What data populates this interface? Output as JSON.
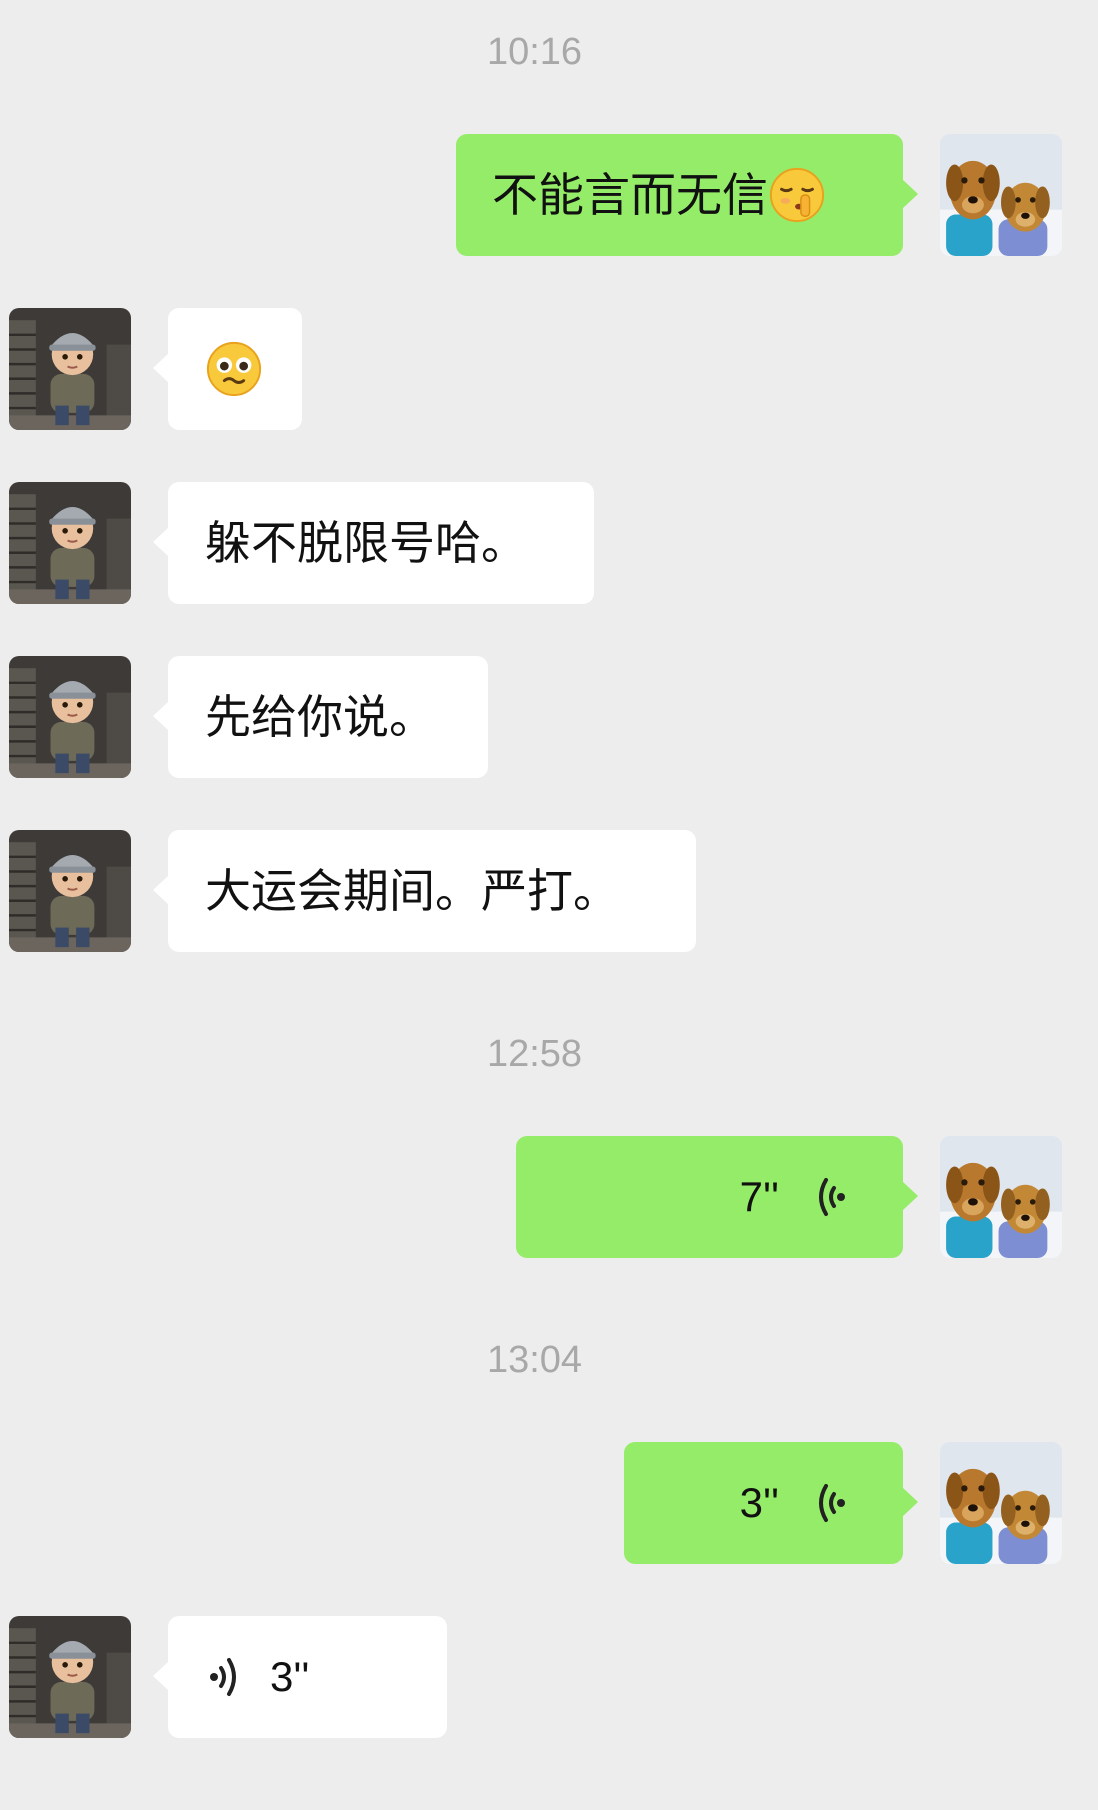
{
  "timestamps": [
    "10:16",
    "12:58",
    "13:04"
  ],
  "messages": [
    {
      "side": "out",
      "type": "text",
      "text": "不能言而无信",
      "emoji": "shushing-face-emoji"
    },
    {
      "side": "in",
      "type": "emoji",
      "emoji": "pleading-face-emoji"
    },
    {
      "side": "in",
      "type": "text",
      "text": "躲不脱限号哈。"
    },
    {
      "side": "in",
      "type": "text",
      "text": "先给你说。"
    },
    {
      "side": "in",
      "type": "text",
      "text": "大运会期间。严打。"
    },
    {
      "side": "out",
      "type": "voice",
      "duration": "7''"
    },
    {
      "side": "out",
      "type": "voice",
      "duration": "3''"
    },
    {
      "side": "in",
      "type": "voice",
      "duration": "3''"
    }
  ],
  "avatars": {
    "self": "two-golden-retrievers-avatar",
    "contact": "toddler-helmet-avatar"
  },
  "colors": {
    "background": "#ededed",
    "outgoing_bubble": "#95ec69",
    "incoming_bubble": "#ffffff",
    "timestamp": "#a8a8a8"
  }
}
